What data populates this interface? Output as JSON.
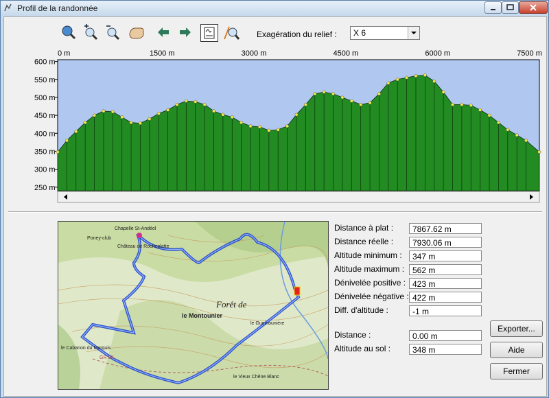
{
  "window": {
    "title": "Profil de la randonnée"
  },
  "toolbar": {
    "relief_label": "Exagération du relief :",
    "relief_value": "X 6",
    "icons": [
      "zoom-fit-icon",
      "zoom-in-icon",
      "zoom-out-icon",
      "pan-hand-icon",
      "arrow-left-icon",
      "arrow-right-icon",
      "profile-view-icon",
      "locate-icon"
    ]
  },
  "chart_data": {
    "type": "area",
    "x_ticks": [
      "0 m",
      "1500 m",
      "3000 m",
      "4500 m",
      "6000 m",
      "7500 m"
    ],
    "y_ticks": [
      "600 m",
      "550 m",
      "500 m",
      "450 m",
      "400 m",
      "350 m",
      "300 m",
      "250 m"
    ],
    "xlim": [
      0,
      7867.62
    ],
    "ylim": [
      240,
      605
    ],
    "x": [
      0,
      150,
      300,
      450,
      600,
      750,
      900,
      1050,
      1200,
      1350,
      1500,
      1650,
      1800,
      1950,
      2100,
      2250,
      2400,
      2550,
      2700,
      2850,
      3000,
      3150,
      3300,
      3450,
      3600,
      3750,
      3900,
      4050,
      4200,
      4350,
      4500,
      4650,
      4800,
      4950,
      5100,
      5250,
      5400,
      5550,
      5700,
      5850,
      6000,
      6150,
      6300,
      6450,
      6600,
      6750,
      6900,
      7050,
      7200,
      7350,
      7500,
      7650,
      7867
    ],
    "y": [
      348,
      380,
      405,
      430,
      450,
      462,
      460,
      445,
      430,
      428,
      440,
      455,
      465,
      480,
      490,
      488,
      480,
      462,
      452,
      445,
      430,
      420,
      418,
      408,
      410,
      420,
      452,
      480,
      510,
      515,
      510,
      500,
      490,
      480,
      485,
      510,
      540,
      550,
      555,
      560,
      562,
      545,
      515,
      480,
      480,
      478,
      465,
      450,
      430,
      410,
      395,
      380,
      348
    ],
    "area_color": "#228b22",
    "plot_bg": "#b0c8f0"
  },
  "stats": [
    {
      "label": "Distance à plat :",
      "value": "7867.62 m"
    },
    {
      "label": "Distance réelle :",
      "value": "7930.06 m"
    },
    {
      "label": "Altitude minimum :",
      "value": "347 m"
    },
    {
      "label": "Altitude maximum :",
      "value": "562 m"
    },
    {
      "label": "Dénivelée positive :",
      "value": "423 m"
    },
    {
      "label": "Dénivelée négative :",
      "value": "422 m"
    },
    {
      "label": "Diff. d'altitude :",
      "value": "-1 m"
    }
  ],
  "position": [
    {
      "label": "Distance :",
      "value": "0.00 m"
    },
    {
      "label": "Altitude au sol :",
      "value": "348 m"
    }
  ],
  "buttons": {
    "export": "Exporter...",
    "help": "Aide",
    "close": "Fermer"
  },
  "map": {
    "labels": [
      "Chapelle St-Andéol",
      "Poney-club",
      "Château de Rocheplatte",
      "le Montounier",
      "Forêt de",
      "le Cabanon du Marquis",
      "le Gueinounière",
      "le Vieux Chêne Blanc",
      "GR 98"
    ]
  }
}
